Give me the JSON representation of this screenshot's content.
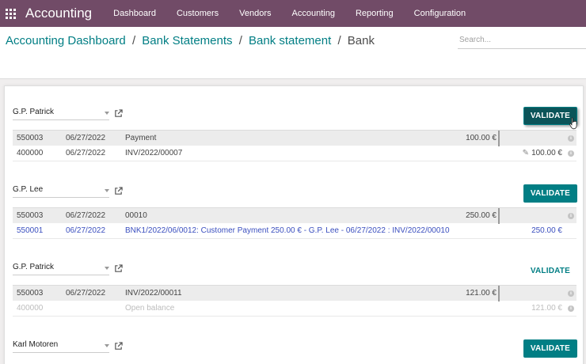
{
  "app": {
    "title": "Accounting",
    "menu": [
      "Dashboard",
      "Customers",
      "Vendors",
      "Accounting",
      "Reporting",
      "Configuration"
    ]
  },
  "breadcrumb": {
    "items": [
      "Accounting Dashboard",
      "Bank Statements",
      "Bank statement"
    ],
    "current": "Bank",
    "separator": "/"
  },
  "search": {
    "placeholder": "Search..."
  },
  "colors": {
    "navbar": "#714b67",
    "accent": "#017e84",
    "link": "#3b4fbf"
  },
  "blocks": [
    {
      "partner": "G.P. Patrick",
      "validate_label": "VALIDATE",
      "head": {
        "account": "550003",
        "date": "06/27/2022",
        "label": "Payment",
        "amount": "100.00 €"
      },
      "match": {
        "account": "400000",
        "date": "06/27/2022",
        "label": "INV/2022/00007",
        "amount": "100.00 €"
      }
    },
    {
      "partner": "G.P. Lee",
      "validate_label": "VALIDATE",
      "head": {
        "account": "550003",
        "date": "06/27/2022",
        "label": "00010",
        "amount": "250.00 €"
      },
      "match": {
        "account": "550001",
        "date": "06/27/2022",
        "label": "BNK1/2022/06/0012: Customer Payment 250.00 € - G.P. Lee - 06/27/2022 : INV/2022/00010",
        "amount": "250.00 €"
      }
    },
    {
      "partner": "G.P. Patrick",
      "validate_label": "VALIDATE",
      "head": {
        "account": "550003",
        "date": "06/27/2022",
        "label": "INV/2022/00011",
        "amount": "121.00 €"
      },
      "match": {
        "account": "400000",
        "date": "",
        "label": "Open balance",
        "amount": "121.00 €"
      }
    },
    {
      "partner": "Karl Motoren",
      "validate_label": "VALIDATE"
    }
  ]
}
